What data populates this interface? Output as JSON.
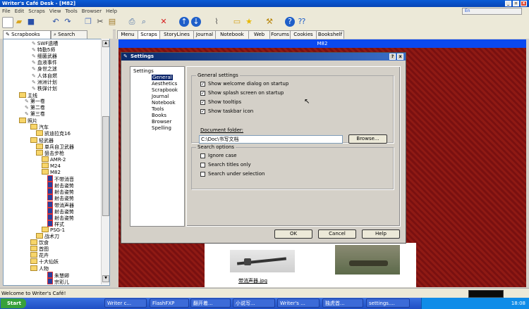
{
  "window": {
    "title": "Writer's Café Desk - [M82]"
  },
  "menubar": {
    "items": [
      "File",
      "Edit",
      "Scraps",
      "View",
      "Tools",
      "Browser",
      "Help"
    ]
  },
  "langbar": {
    "label": "En"
  },
  "lefttabs": {
    "scrapbooks": "Scrapbooks",
    "search": "Search"
  },
  "tree": {
    "rows": [
      {
        "label": "SWF遗槽",
        "icon": "pen"
      },
      {
        "label": "特勤5师",
        "icon": "pen"
      },
      {
        "label": "细菌武器",
        "icon": "pen"
      },
      {
        "label": "血液事件",
        "icon": "pen"
      },
      {
        "label": "身世之迷",
        "icon": "pen"
      },
      {
        "label": "人体自燃",
        "icon": "pen"
      },
      {
        "label": "洲洲计划",
        "icon": "pen"
      },
      {
        "label": "秩弹计划",
        "icon": "pen"
      },
      {
        "label": "主线",
        "icon": "folder"
      },
      {
        "label": "第一卷",
        "icon": "pen"
      },
      {
        "label": "第二卷",
        "icon": "pen"
      },
      {
        "label": "第三卷",
        "icon": "pen"
      },
      {
        "label": "照片",
        "icon": "folder"
      },
      {
        "label": "汽车",
        "icon": "folder"
      },
      {
        "label": "凯迪拉克16",
        "icon": "folder"
      },
      {
        "label": "轻武器",
        "icon": "folder"
      },
      {
        "label": "单兵自卫武器",
        "icon": "folder"
      },
      {
        "label": "狙击步枪",
        "icon": "folder"
      },
      {
        "label": "AMR-2",
        "icon": "folder"
      },
      {
        "label": "M24",
        "icon": "folder"
      },
      {
        "label": "M82",
        "icon": "folder"
      },
      {
        "label": "不带消音",
        "icon": "doc"
      },
      {
        "label": "射击姿势",
        "icon": "doc"
      },
      {
        "label": "射击姿势",
        "icon": "doc"
      },
      {
        "label": "射击姿势",
        "icon": "doc"
      },
      {
        "label": "带消声器",
        "icon": "doc"
      },
      {
        "label": "射击姿势",
        "icon": "doc"
      },
      {
        "label": "射击姿势",
        "icon": "doc"
      },
      {
        "label": "样式",
        "icon": "doc"
      },
      {
        "label": "PSG-1",
        "icon": "folder"
      },
      {
        "label": "战术刀",
        "icon": "folder"
      },
      {
        "label": "饮食",
        "icon": "folder"
      },
      {
        "label": "首图",
        "icon": "folder"
      },
      {
        "label": "花卉",
        "icon": "folder"
      },
      {
        "label": "十大仙妖",
        "icon": "folder"
      },
      {
        "label": "人物",
        "icon": "folder"
      },
      {
        "label": "朱慧卿",
        "icon": "doc"
      },
      {
        "label": "宗彩儿",
        "icon": "doc"
      }
    ]
  },
  "righttabs": [
    "Menu",
    "Scraps",
    "StoryLines",
    "Journal",
    "Notebook",
    "Web",
    "Forums",
    "Cookies",
    "Bookshelf"
  ],
  "bluebar": {
    "title": "M82"
  },
  "gallery": {
    "caption1": "带消声器.jpg"
  },
  "dialog": {
    "title": "Settings",
    "tree": [
      "Settings",
      "General",
      "Aesthetics",
      "Scrapbook",
      "Journal",
      "Notebook",
      "Tools",
      "Books",
      "Browser",
      "Spelling"
    ],
    "general": {
      "title": "General settings",
      "checks": [
        {
          "label": "Show welcome dialog on startup",
          "checked": true
        },
        {
          "label": "Show splash screen on startup",
          "checked": true
        },
        {
          "label": "Show tooltips",
          "checked": true
        },
        {
          "label": "Show taskbar icon",
          "checked": true
        }
      ],
      "doc_folder_label": "Document folder:",
      "doc_folder_value": "C:\\Doc\\书写文档",
      "browse": "Browse..."
    },
    "search": {
      "title": "Search options",
      "checks": [
        {
          "label": "Ignore case",
          "checked": false
        },
        {
          "label": "Search titles only",
          "checked": false
        },
        {
          "label": "Search under selection",
          "checked": false
        }
      ]
    },
    "buttons": {
      "ok": "OK",
      "cancel": "Cancel",
      "help": "Help"
    }
  },
  "status": {
    "text": "Welcome to Writer's Café!"
  },
  "taskbar": {
    "start": "Start",
    "tasks": [
      "Writer c...",
      "FlashFXP",
      "翻开着...",
      "小说写...",
      "Writer's ...",
      "独虎首...",
      "settings...."
    ],
    "clock": "18:08"
  }
}
